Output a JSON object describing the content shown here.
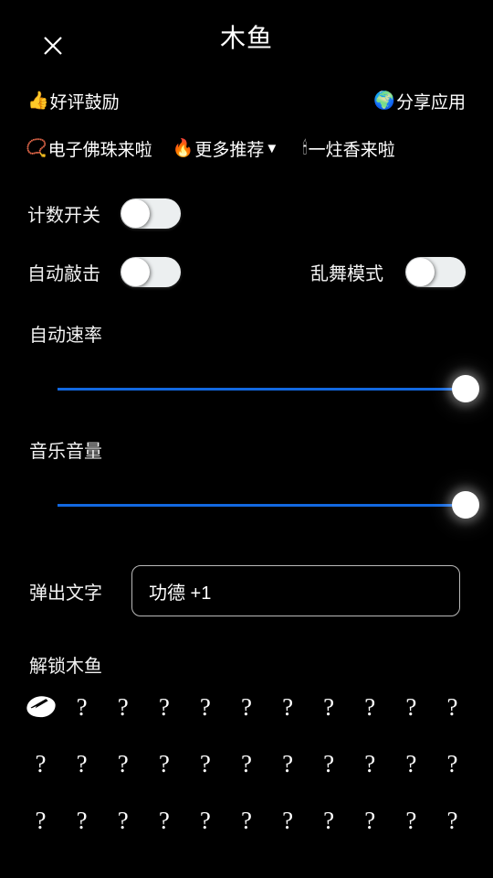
{
  "header": {
    "close_icon": "close-icon",
    "title": "木鱼"
  },
  "promo": {
    "row_one": [
      {
        "emoji": "👍",
        "icon_name": "thumbs-up-icon",
        "label": "好评鼓励"
      },
      {
        "emoji": "🌍",
        "icon_name": "globe-icon",
        "label": "分享应用"
      }
    ],
    "row_two": [
      {
        "emoji": "📿",
        "icon_name": "prayer-beads-icon",
        "label": "电子佛珠来啦",
        "caret": ""
      },
      {
        "emoji": "🔥",
        "icon_name": "fire-icon",
        "label": "更多推荐",
        "caret": "▼"
      },
      {
        "emoji": "🕯",
        "icon_name": "candle-icon",
        "label": "一炷香来啦",
        "caret": ""
      }
    ]
  },
  "settings": {
    "count_switch": {
      "label": "计数开关",
      "state": "off"
    },
    "auto_tap": {
      "label": "自动敲击",
      "state": "off"
    },
    "chaos_mode": {
      "label": "乱舞模式",
      "state": "off"
    },
    "auto_speed": {
      "label": "自动速率",
      "value": 100,
      "min": 0,
      "max": 100
    },
    "music_volume": {
      "label": "音乐音量",
      "value": 100,
      "min": 0,
      "max": 100
    },
    "popup_text": {
      "label": "弹出文字",
      "value": "功德 +1",
      "placeholder": "功德 +1"
    }
  },
  "unlock": {
    "title": "解锁木鱼",
    "columns": 11,
    "items": [
      {
        "type": "icon",
        "icon_name": "wooden-fish-icon",
        "label": "",
        "unlocked": true
      },
      {
        "type": "locked",
        "label": "?"
      },
      {
        "type": "locked",
        "label": "?"
      },
      {
        "type": "locked",
        "label": "?"
      },
      {
        "type": "locked",
        "label": "?"
      },
      {
        "type": "locked",
        "label": "?"
      },
      {
        "type": "locked",
        "label": "?"
      },
      {
        "type": "locked",
        "label": "?"
      },
      {
        "type": "locked",
        "label": "?"
      },
      {
        "type": "locked",
        "label": "?"
      },
      {
        "type": "locked",
        "label": "?"
      },
      {
        "type": "locked",
        "label": "?"
      },
      {
        "type": "locked",
        "label": "?"
      },
      {
        "type": "locked",
        "label": "?"
      },
      {
        "type": "locked",
        "label": "?"
      },
      {
        "type": "locked",
        "label": "?"
      },
      {
        "type": "locked",
        "label": "?"
      },
      {
        "type": "locked",
        "label": "?"
      },
      {
        "type": "locked",
        "label": "?"
      },
      {
        "type": "locked",
        "label": "?"
      },
      {
        "type": "locked",
        "label": "?"
      },
      {
        "type": "locked",
        "label": "?"
      },
      {
        "type": "locked",
        "label": "?"
      },
      {
        "type": "locked",
        "label": "?"
      },
      {
        "type": "locked",
        "label": "?"
      },
      {
        "type": "locked",
        "label": "?"
      },
      {
        "type": "locked",
        "label": "?"
      },
      {
        "type": "locked",
        "label": "?"
      },
      {
        "type": "locked",
        "label": "?"
      },
      {
        "type": "locked",
        "label": "?"
      },
      {
        "type": "locked",
        "label": "?"
      },
      {
        "type": "locked",
        "label": "?"
      },
      {
        "type": "locked",
        "label": "?"
      }
    ]
  },
  "colors": {
    "background": "#000000",
    "text": "#ffffff",
    "slider_fill": "#1268e0",
    "slider_thumb": "#ffffff",
    "switch_track": "#eceff0",
    "field_border": "#b9b9b9"
  }
}
